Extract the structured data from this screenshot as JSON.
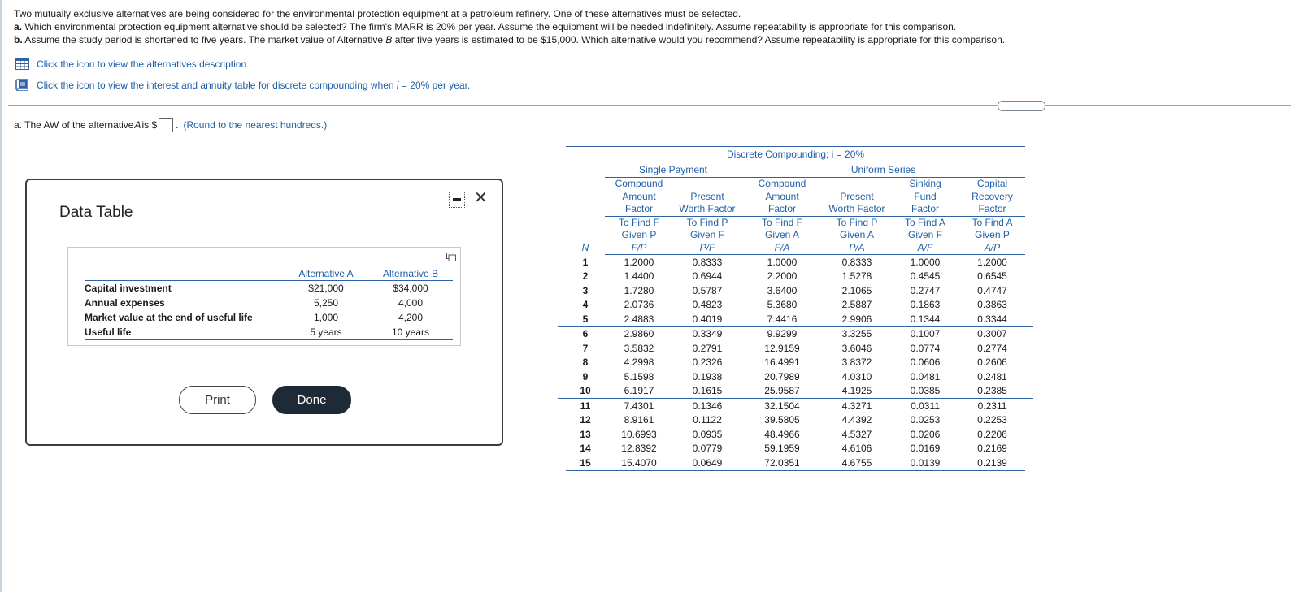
{
  "problem": {
    "intro": "Two mutually exclusive alternatives are being considered for the environmental protection equipment at a petroleum refinery. One of these alternatives must be selected.",
    "part_a_label": "a.",
    "part_a_text": "Which environmental protection equipment alternative should be selected? The firm's MARR is 20% per year. Assume the equipment will be needed indefinitely. Assume repeatability is appropriate for this comparison.",
    "part_b_label": "b.",
    "part_b_pre": "Assume the study period is shortened to five years. The market value of Alternative ",
    "part_b_italic": "B",
    "part_b_post": " after five years is estimated to be $15,000. Which alternative would you recommend? Assume repeatability is appropriate for this comparison."
  },
  "links": {
    "alternatives": "Click the icon to view the alternatives description.",
    "interest_table_pre": "Click the icon to view the interest and annuity table for discrete compounding when ",
    "interest_table_i": "i",
    "interest_table_post": " = 20% per year."
  },
  "more_button": ".....",
  "question": {
    "pre": "a. The AW of the alternative ",
    "alt": "A",
    "mid": " is $",
    "answer_value": "",
    "post": ".",
    "hint": "(Round to the nearest hundreds.)"
  },
  "dialog": {
    "title": "Data Table",
    "close_symbol": "✕",
    "table": {
      "headers": [
        "Alternative A",
        "Alternative B"
      ],
      "rows": [
        {
          "label": "Capital investment",
          "a": "$21,000",
          "b": "$34,000"
        },
        {
          "label": "Annual expenses",
          "a": "5,250",
          "b": "4,000"
        },
        {
          "label": "Market value at the end of useful life",
          "a": "1,000",
          "b": "4,200"
        },
        {
          "label": "Useful life",
          "a": "5 years",
          "b": "10 years"
        }
      ]
    },
    "print_label": "Print",
    "done_label": "Done"
  },
  "compounding": {
    "title": "Discrete Compounding; i = 20%",
    "group_single": "Single Payment",
    "group_uniform": "Uniform Series",
    "col_names": [
      [
        "Compound",
        "Amount",
        "Factor"
      ],
      [
        "",
        "Present",
        "Worth Factor"
      ],
      [
        "Compound",
        "Amount",
        "Factor"
      ],
      [
        "",
        "Present",
        "Worth Factor"
      ],
      [
        "Sinking",
        "Fund",
        "Factor"
      ],
      [
        "Capital",
        "Recovery",
        "Factor"
      ]
    ],
    "col_find": [
      [
        "To Find F",
        "Given P",
        "F/P"
      ],
      [
        "To Find P",
        "Given F",
        "P/F"
      ],
      [
        "To Find F",
        "Given A",
        "F/A"
      ],
      [
        "To Find P",
        "Given A",
        "P/A"
      ],
      [
        "To Find A",
        "Given F",
        "A/F"
      ],
      [
        "To Find A",
        "Given P",
        "A/P"
      ]
    ],
    "n_label": "N",
    "rows": [
      [
        "1",
        "1.2000",
        "0.8333",
        "1.0000",
        "0.8333",
        "1.0000",
        "1.2000"
      ],
      [
        "2",
        "1.4400",
        "0.6944",
        "2.2000",
        "1.5278",
        "0.4545",
        "0.6545"
      ],
      [
        "3",
        "1.7280",
        "0.5787",
        "3.6400",
        "2.1065",
        "0.2747",
        "0.4747"
      ],
      [
        "4",
        "2.0736",
        "0.4823",
        "5.3680",
        "2.5887",
        "0.1863",
        "0.3863"
      ],
      [
        "5",
        "2.4883",
        "0.4019",
        "7.4416",
        "2.9906",
        "0.1344",
        "0.3344"
      ],
      [
        "6",
        "2.9860",
        "0.3349",
        "9.9299",
        "3.3255",
        "0.1007",
        "0.3007"
      ],
      [
        "7",
        "3.5832",
        "0.2791",
        "12.9159",
        "3.6046",
        "0.0774",
        "0.2774"
      ],
      [
        "8",
        "4.2998",
        "0.2326",
        "16.4991",
        "3.8372",
        "0.0606",
        "0.2606"
      ],
      [
        "9",
        "5.1598",
        "0.1938",
        "20.7989",
        "4.0310",
        "0.0481",
        "0.2481"
      ],
      [
        "10",
        "6.1917",
        "0.1615",
        "25.9587",
        "4.1925",
        "0.0385",
        "0.2385"
      ],
      [
        "11",
        "7.4301",
        "0.1346",
        "32.1504",
        "4.3271",
        "0.0311",
        "0.2311"
      ],
      [
        "12",
        "8.9161",
        "0.1122",
        "39.5805",
        "4.4392",
        "0.0253",
        "0.2253"
      ],
      [
        "13",
        "10.6993",
        "0.0935",
        "48.4966",
        "4.5327",
        "0.0206",
        "0.2206"
      ],
      [
        "14",
        "12.8392",
        "0.0779",
        "59.1959",
        "4.6106",
        "0.0169",
        "0.2169"
      ],
      [
        "15",
        "15.4070",
        "0.0649",
        "72.0351",
        "4.6755",
        "0.0139",
        "0.2139"
      ]
    ]
  },
  "colors": {
    "link": "#1f5fa6",
    "rule": "#2f62a5",
    "done_bg": "#1e2b36"
  },
  "icons": {
    "alternatives": "table-grid-icon",
    "interest": "book-icon",
    "copy": "copy-icon",
    "minimize": "minimize-icon",
    "close": "close-icon"
  }
}
